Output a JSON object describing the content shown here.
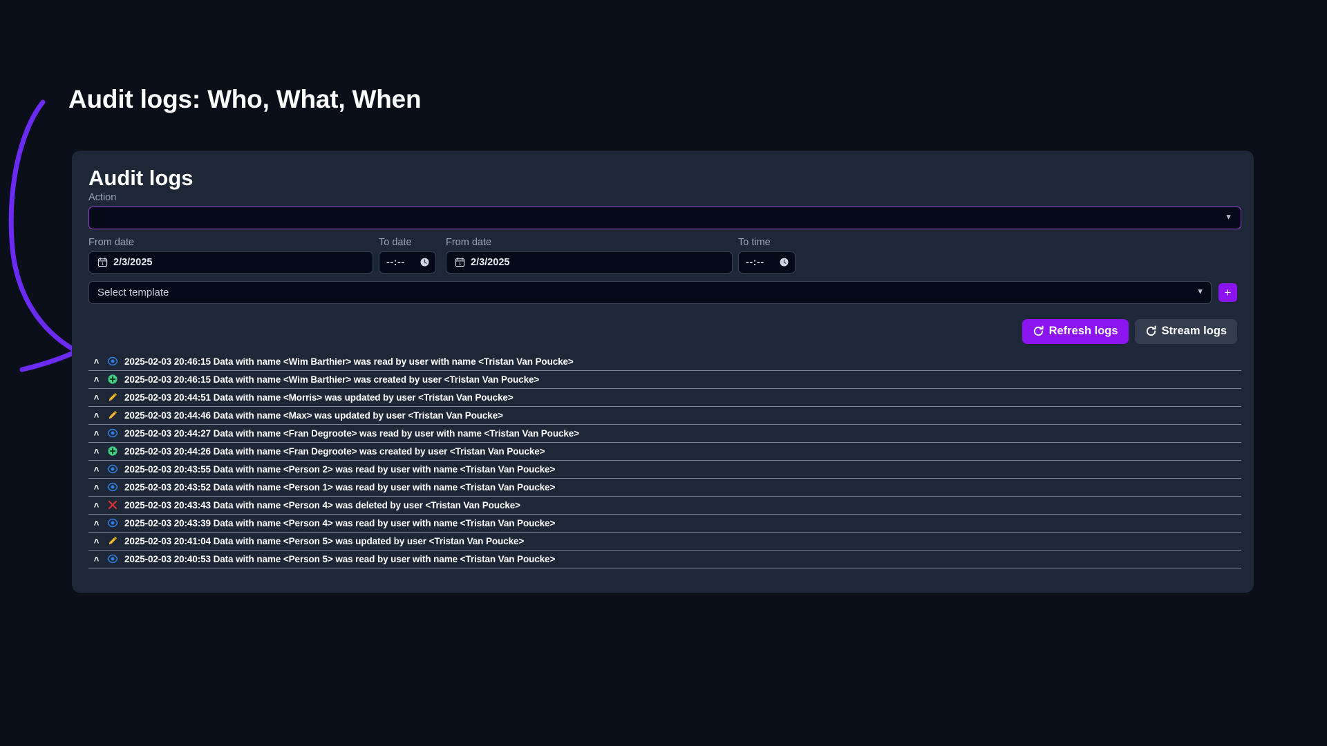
{
  "page": {
    "heading": "Audit logs: Who, What, When",
    "background_color": "#0b0f1a",
    "accent_color": "#8b14f0",
    "annotation": {
      "name": "hand-drawn-arrow",
      "color": "#6b2bf5",
      "points_to": "first-log-row"
    }
  },
  "card": {
    "title": "Audit logs",
    "background_color": "#1e2738",
    "action_field": {
      "label": "Action",
      "value": "",
      "placeholder": "",
      "focused": true,
      "border_color": "#9a3ed8",
      "chevron": "chevron-down-icon"
    },
    "filters": [
      {
        "label": "From date",
        "type": "date",
        "value": "2/3/2025",
        "icon": "calendar-icon"
      },
      {
        "label": "To date",
        "type": "time",
        "value": "--:--",
        "icon": "clock-icon"
      },
      {
        "label": "From date",
        "type": "date",
        "value": "2/3/2025",
        "icon": "calendar-icon"
      },
      {
        "label": "To time",
        "type": "time",
        "value": "--:--",
        "icon": "clock-icon"
      }
    ],
    "template": {
      "placeholder": "Select template",
      "value": "Select template",
      "chevron": "chevron-down-icon",
      "add_button_label": "+"
    },
    "buttons": [
      {
        "label": "Refresh logs",
        "icon": "refresh-icon",
        "style": "primary"
      },
      {
        "label": "Stream logs",
        "icon": "refresh-icon",
        "style": "secondary"
      }
    ],
    "logs": [
      {
        "caret": "˄",
        "icon": "eye-icon",
        "icon_color": "#2f7ee0",
        "text": "2025-02-03 20:46:15 Data with name <Wim Barthier> was read by user with name <Tristan Van Poucke>"
      },
      {
        "caret": "˄",
        "icon": "plus-circle-icon",
        "icon_color": "#3ccf84",
        "text": "2025-02-03 20:46:15 Data with name <Wim Barthier> was created by user <Tristan Van Poucke>"
      },
      {
        "caret": "˄",
        "icon": "pencil-icon",
        "icon_color": "#f0b429",
        "text": "2025-02-03 20:44:51 Data with name <Morris> was updated by user <Tristan Van Poucke>"
      },
      {
        "caret": "˄",
        "icon": "pencil-icon",
        "icon_color": "#f0b429",
        "text": "2025-02-03 20:44:46 Data with name <Max> was updated by user <Tristan Van Poucke>"
      },
      {
        "caret": "˄",
        "icon": "eye-icon",
        "icon_color": "#2f7ee0",
        "text": "2025-02-03 20:44:27 Data with name <Fran Degroote> was read by user with name <Tristan Van Poucke>"
      },
      {
        "caret": "˄",
        "icon": "plus-circle-icon",
        "icon_color": "#3ccf84",
        "text": "2025-02-03 20:44:26 Data with name <Fran Degroote> was created by user <Tristan Van Poucke>"
      },
      {
        "caret": "˄",
        "icon": "eye-icon",
        "icon_color": "#2f7ee0",
        "text": "2025-02-03 20:43:55 Data with name <Person 2> was read by user with name <Tristan Van Poucke>"
      },
      {
        "caret": "˄",
        "icon": "eye-icon",
        "icon_color": "#2f7ee0",
        "text": "2025-02-03 20:43:52 Data with name <Person 1> was read by user with name <Tristan Van Poucke>"
      },
      {
        "caret": "˄",
        "icon": "cross-icon",
        "icon_color": "#e03131",
        "text": "2025-02-03 20:43:43 Data with name <Person 4> was deleted by user <Tristan Van Poucke>"
      },
      {
        "caret": "˄",
        "icon": "eye-icon",
        "icon_color": "#2f7ee0",
        "text": "2025-02-03 20:43:39 Data with name <Person 4> was read by user with name <Tristan Van Poucke>"
      },
      {
        "caret": "˄",
        "icon": "pencil-icon",
        "icon_color": "#f0b429",
        "text": "2025-02-03 20:41:04 Data with name <Person 5> was updated by user <Tristan Van Poucke>"
      },
      {
        "caret": "˄",
        "icon": "eye-icon",
        "icon_color": "#2f7ee0",
        "text": "2025-02-03 20:40:53 Data with name <Person 5> was read by user with name <Tristan Van Poucke>"
      }
    ]
  }
}
